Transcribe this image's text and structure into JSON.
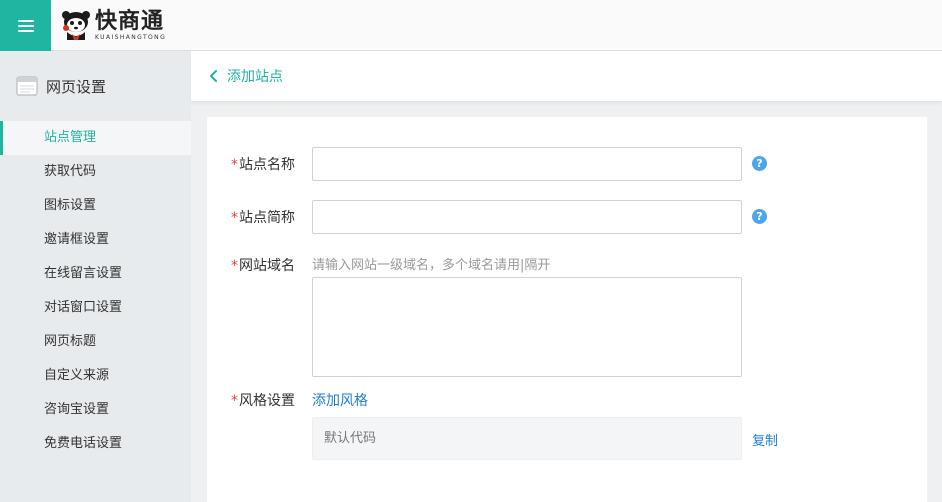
{
  "header": {
    "menu_icon": "hamburger-icon",
    "logo_cn": "快商通",
    "logo_en": "KUAISHANGTONG",
    "accent_color": "#1fb5a0"
  },
  "sidebar": {
    "title": "网页设置",
    "title_icon": "browser-window-icon",
    "items": [
      {
        "label": "站点管理",
        "active": true
      },
      {
        "label": "获取代码"
      },
      {
        "label": "图标设置"
      },
      {
        "label": "邀请框设置"
      },
      {
        "label": "在线留言设置"
      },
      {
        "label": "对话窗口设置"
      },
      {
        "label": "网页标题"
      },
      {
        "label": "自定义来源"
      },
      {
        "label": "咨询宝设置"
      },
      {
        "label": "免费电话设置"
      }
    ]
  },
  "page": {
    "back_label": "添加站点",
    "back_icon": "chevron-left-icon"
  },
  "form": {
    "required_mark": "*",
    "site_name": {
      "label": "站点名称",
      "value": "",
      "help": "?"
    },
    "site_short": {
      "label": "站点简称",
      "value": "",
      "help": "?"
    },
    "domain": {
      "label": "网站域名",
      "hint": "请输入网站一级域名，多个域名请用|隔开",
      "value": ""
    },
    "style": {
      "label": "风格设置",
      "add_link": "添加风格",
      "default_code": "默认代码",
      "copy_link": "复制"
    }
  },
  "colors": {
    "link": "#1f7fcf",
    "required": "#e2443b",
    "help": "#4aa8ea"
  }
}
